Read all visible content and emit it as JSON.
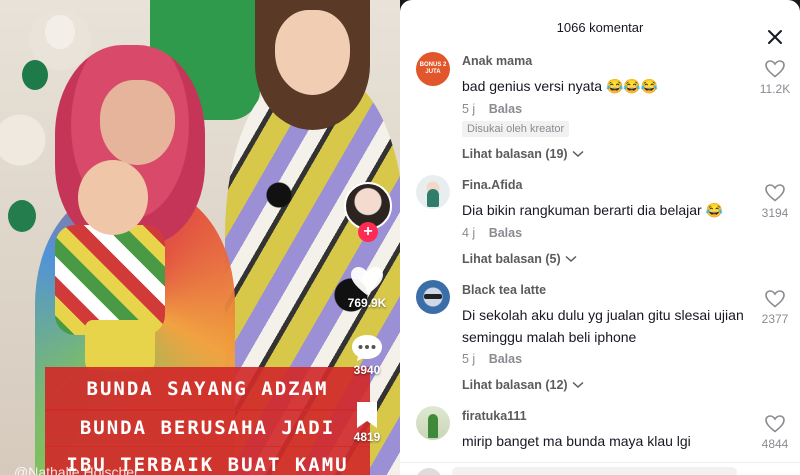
{
  "video": {
    "watermark": "@Nathalie Holscher",
    "caption_lines": [
      "BUNDA SAYANG ADZAM",
      "BUNDA BERUSAHA JADI",
      "IBU TERBAIK BUAT KAMU"
    ],
    "like_count": "769.9K",
    "comment_count": "3940",
    "save_count": "4819"
  },
  "comments_panel": {
    "title": "1066 komentar",
    "comments": [
      {
        "username": "Anak mama",
        "avatar_badge": "BONUS 2 JUTA",
        "text": "bad genius versi nyata 😂😂😂",
        "time": "5 j",
        "reply_label": "Balas",
        "creator_liked": "Disukai oleh kreator",
        "view_replies": "Lihat balasan (19)",
        "likes": "11.2K"
      },
      {
        "username": "Fina.Afida",
        "text": "Dia bikin rangkuman berarti dia belajar 😂",
        "time": "4 j",
        "reply_label": "Balas",
        "view_replies": "Lihat balasan (5)",
        "likes": "3194"
      },
      {
        "username": "Black tea latte",
        "text": "Di sekolah aku dulu yg jualan gitu slesai ujian seminggu malah beli iphone",
        "time": "5 j",
        "reply_label": "Balas",
        "view_replies": "Lihat balasan (12)",
        "likes": "2377"
      },
      {
        "username": "firatuka111",
        "text": "mirip banget ma bunda maya klau lgi",
        "likes": "4844"
      }
    ]
  },
  "colors": {
    "caption_bg": "#d02a2a",
    "follow_plus": "#fe2c55",
    "panel_bg": "#ffffff"
  }
}
